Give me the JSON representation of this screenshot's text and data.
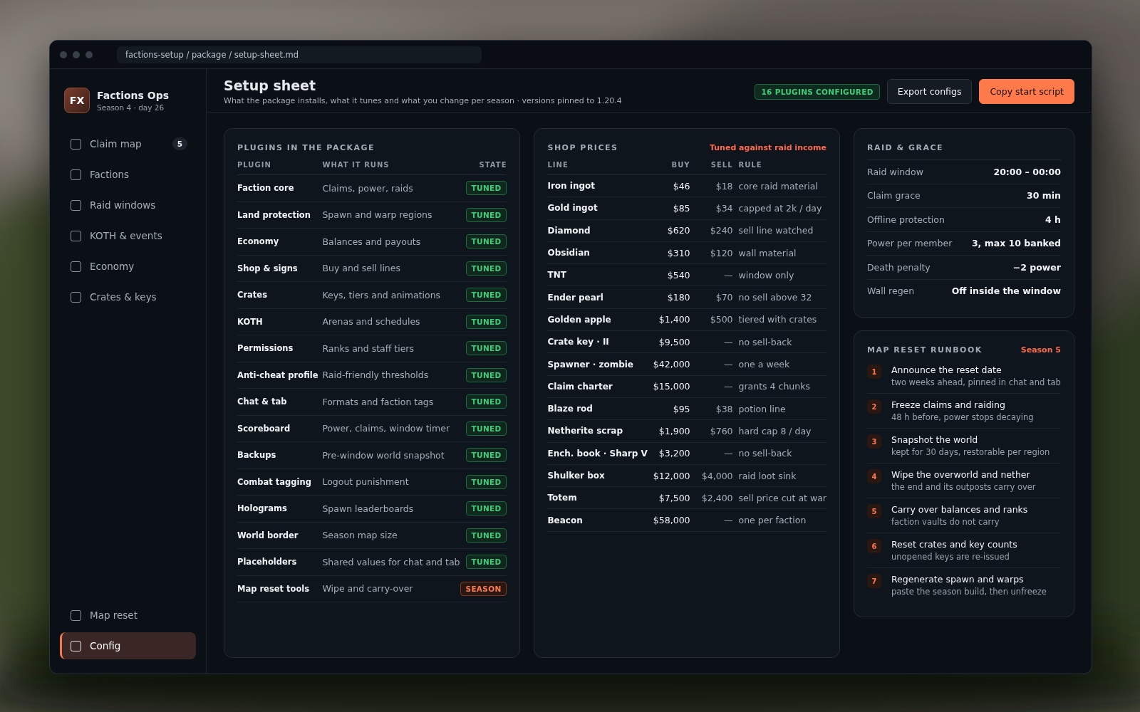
{
  "window": {
    "path": "factions-setup / package / setup-sheet.md"
  },
  "brand": {
    "logo": "FX",
    "name": "Factions Ops",
    "subtitle": "Season 4 · day 26"
  },
  "nav": {
    "items": [
      {
        "label": "Claim map",
        "selected": false,
        "badge": "5"
      },
      {
        "label": "Factions",
        "selected": false
      },
      {
        "label": "Raid windows",
        "selected": false
      },
      {
        "label": "KOTH & events",
        "selected": false
      },
      {
        "label": "Economy",
        "selected": false
      },
      {
        "label": "Crates & keys",
        "selected": false
      }
    ],
    "bottom_items": [
      {
        "label": "Map reset",
        "selected": false
      },
      {
        "label": "Config",
        "selected": true
      }
    ]
  },
  "header": {
    "title": "Setup sheet",
    "subtitle": "What the package installs, what it tunes and what you change per season · versions pinned to 1.20.4",
    "count_badge": "16 PLUGINS CONFIGURED",
    "buttons": [
      {
        "label": "Export configs",
        "kind": "secondary"
      },
      {
        "label": "Copy start script",
        "kind": "primary"
      }
    ]
  },
  "plugins": {
    "title": "PLUGINS IN THE PACKAGE",
    "columns": [
      "PLUGIN",
      "WHAT IT RUNS",
      "STATE"
    ],
    "rows": [
      {
        "name": "Faction core",
        "runs": "Claims, power, raids",
        "state": "TUNED",
        "kind": "tuned"
      },
      {
        "name": "Land protection",
        "runs": "Spawn and warp regions",
        "state": "TUNED",
        "kind": "tuned"
      },
      {
        "name": "Economy",
        "runs": "Balances and payouts",
        "state": "TUNED",
        "kind": "tuned"
      },
      {
        "name": "Shop & signs",
        "runs": "Buy and sell lines",
        "state": "TUNED",
        "kind": "tuned"
      },
      {
        "name": "Crates",
        "runs": "Keys, tiers and animations",
        "state": "TUNED",
        "kind": "tuned"
      },
      {
        "name": "KOTH",
        "runs": "Arenas and schedules",
        "state": "TUNED",
        "kind": "tuned"
      },
      {
        "name": "Permissions",
        "runs": "Ranks and staff tiers",
        "state": "TUNED",
        "kind": "tuned"
      },
      {
        "name": "Anti-cheat profile",
        "runs": "Raid-friendly thresholds",
        "state": "TUNED",
        "kind": "tuned"
      },
      {
        "name": "Chat & tab",
        "runs": "Formats and faction tags",
        "state": "TUNED",
        "kind": "tuned"
      },
      {
        "name": "Scoreboard",
        "runs": "Power, claims, window timer",
        "state": "TUNED",
        "kind": "tuned"
      },
      {
        "name": "Backups",
        "runs": "Pre-window world snapshot",
        "state": "TUNED",
        "kind": "tuned"
      },
      {
        "name": "Combat tagging",
        "runs": "Logout punishment",
        "state": "TUNED",
        "kind": "tuned"
      },
      {
        "name": "Holograms",
        "runs": "Spawn leaderboards",
        "state": "TUNED",
        "kind": "tuned"
      },
      {
        "name": "World border",
        "runs": "Season map size",
        "state": "TUNED",
        "kind": "tuned"
      },
      {
        "name": "Placeholders",
        "runs": "Shared values for chat and tab",
        "state": "TUNED",
        "kind": "tuned"
      },
      {
        "name": "Map reset tools",
        "runs": "Wipe and carry-over",
        "state": "SEASON",
        "kind": "season"
      }
    ]
  },
  "shop": {
    "title": "SHOP PRICES",
    "note": "Tuned against raid income",
    "columns": [
      "LINE",
      "BUY",
      "SELL",
      "RULE"
    ],
    "rows": [
      {
        "line": "Iron ingot",
        "buy": "$46",
        "sell": "$18",
        "rule": "core raid material"
      },
      {
        "line": "Gold ingot",
        "buy": "$85",
        "sell": "$34",
        "rule": "capped at 2k / day"
      },
      {
        "line": "Diamond",
        "buy": "$620",
        "sell": "$240",
        "rule": "sell line watched"
      },
      {
        "line": "Obsidian",
        "buy": "$310",
        "sell": "$120",
        "rule": "wall material"
      },
      {
        "line": "TNT",
        "buy": "$540",
        "sell": "—",
        "rule": "window only"
      },
      {
        "line": "Ender pearl",
        "buy": "$180",
        "sell": "$70",
        "rule": "no sell above 32"
      },
      {
        "line": "Golden apple",
        "buy": "$1,400",
        "sell": "$500",
        "rule": "tiered with crates"
      },
      {
        "line": "Crate key · II",
        "buy": "$9,500",
        "sell": "—",
        "rule": "no sell-back"
      },
      {
        "line": "Spawner · zombie",
        "buy": "$42,000",
        "sell": "—",
        "rule": "one a week"
      },
      {
        "line": "Claim charter",
        "buy": "$15,000",
        "sell": "—",
        "rule": "grants 4 chunks"
      },
      {
        "line": "Blaze rod",
        "buy": "$95",
        "sell": "$38",
        "rule": "potion line"
      },
      {
        "line": "Netherite scrap",
        "buy": "$1,900",
        "sell": "$760",
        "rule": "hard cap 8 / day"
      },
      {
        "line": "Ench. book · Sharp V",
        "buy": "$3,200",
        "sell": "—",
        "rule": "no sell-back"
      },
      {
        "line": "Shulker box",
        "buy": "$12,000",
        "sell": "$4,000",
        "rule": "raid loot sink"
      },
      {
        "line": "Totem",
        "buy": "$7,500",
        "sell": "$2,400",
        "rule": "sell price cut at war"
      },
      {
        "line": "Beacon",
        "buy": "$58,000",
        "sell": "—",
        "rule": "one per faction"
      }
    ]
  },
  "raid": {
    "title": "RAID & GRACE",
    "rows": [
      {
        "label": "Raid window",
        "value": "20:00 – 00:00"
      },
      {
        "label": "Claim grace",
        "value": "30 min"
      },
      {
        "label": "Offline protection",
        "value": "4 h"
      },
      {
        "label": "Power per member",
        "value": "3, max 10 banked"
      },
      {
        "label": "Death penalty",
        "value": "−2 power"
      },
      {
        "label": "Wall regen",
        "value": "Off inside the window"
      }
    ]
  },
  "runbook": {
    "title": "MAP RESET RUNBOOK",
    "note": "Season 5",
    "steps": [
      {
        "number": "1",
        "title": "Announce the reset date",
        "detail": "two weeks ahead, pinned in chat and tab"
      },
      {
        "number": "2",
        "title": "Freeze claims and raiding",
        "detail": "48 h before, power stops decaying"
      },
      {
        "number": "3",
        "title": "Snapshot the world",
        "detail": "kept for 30 days, restorable per region"
      },
      {
        "number": "4",
        "title": "Wipe the overworld and nether",
        "detail": "the end and its outposts carry over"
      },
      {
        "number": "5",
        "title": "Carry over balances and ranks",
        "detail": "faction vaults do not carry"
      },
      {
        "number": "6",
        "title": "Reset crates and key counts",
        "detail": "unopened keys are re-issued"
      },
      {
        "number": "7",
        "title": "Regenerate spawn and warps",
        "detail": "paste the season build, then unfreeze"
      }
    ]
  }
}
